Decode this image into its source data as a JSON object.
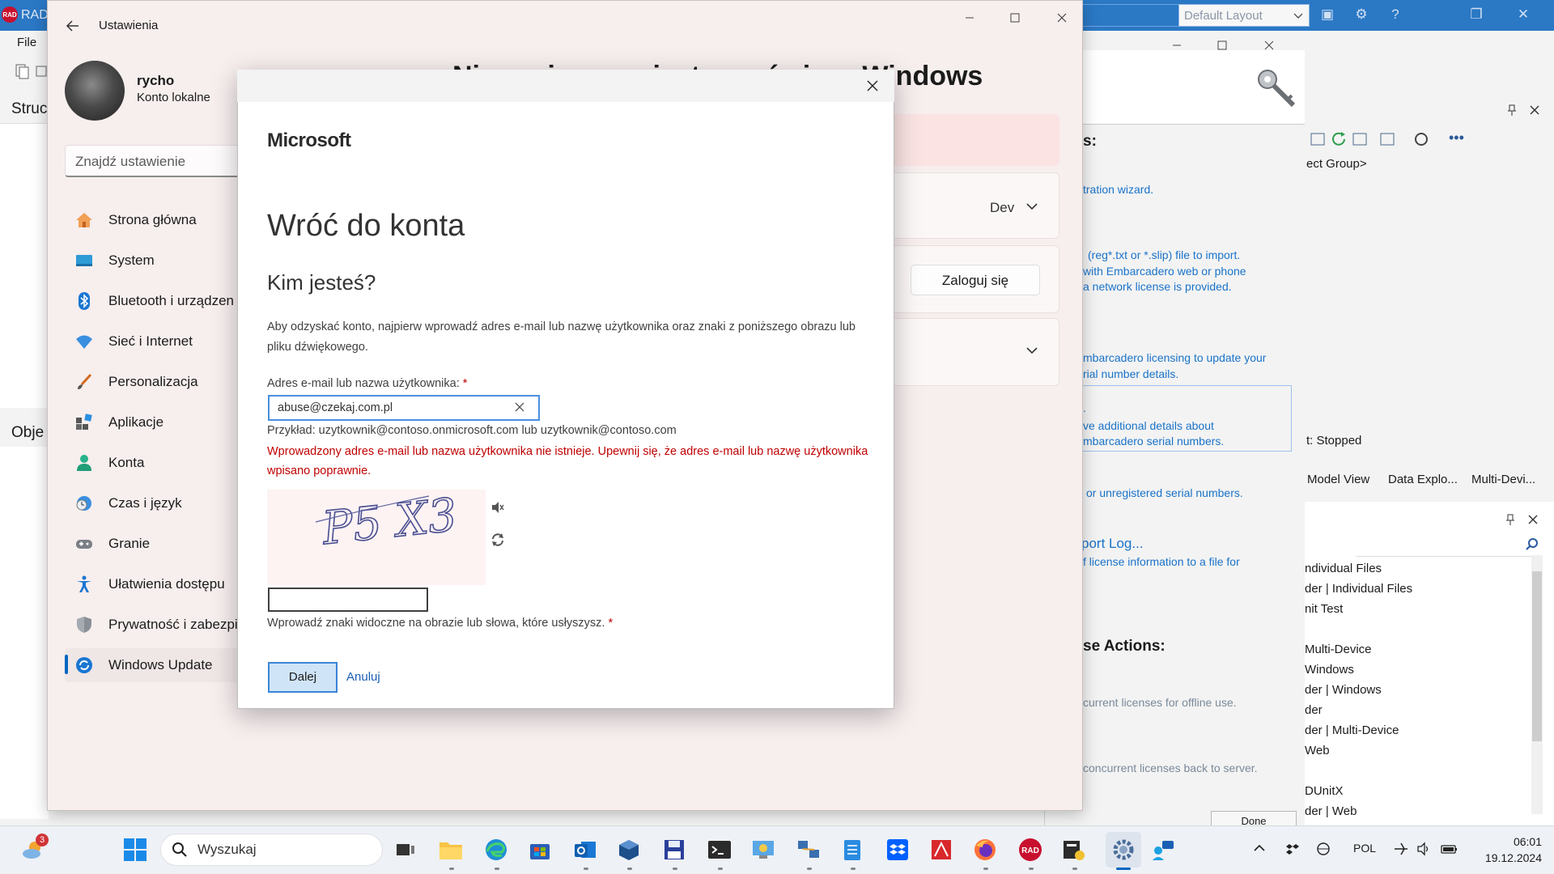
{
  "rad": {
    "logo": "RAD",
    "title": "RAD",
    "layout_select": "Default Layout",
    "menu_file": "File",
    "struct_label": "Struc",
    "obj_label": "Obje",
    "project_group": "ect Group>",
    "status": "t: Stopped",
    "tabs": [
      "Model View",
      "Data Explo...",
      "Multi-Devi..."
    ],
    "file_items": [
      "ndividual Files",
      "der | Individual Files",
      "nit Test",
      "",
      "Multi-Device",
      "Windows",
      "der | Windows",
      "der",
      "der | Multi-Device",
      "Web",
      "",
      "DUnitX",
      "der | Web"
    ],
    "done_label": "Done"
  },
  "license": {
    "heading1": "s:",
    "heading2": "se Actions:",
    "links": [
      "tration wizard.",
      "(reg*.txt or *.slip) file to import.",
      "with Embarcadero web or phone",
      "a network license is provided.",
      "mbarcadero licensing to update your",
      "rial number details.",
      ".",
      "ve additional details about",
      "mbarcadero serial numbers.",
      "or unregistered serial numbers.",
      "port Log...",
      "f  license information to a file for",
      "current licenses for offline use.",
      "concurrent licenses back to server."
    ]
  },
  "settings": {
    "title": "Ustawienia",
    "user_name": "rycho",
    "user_type": "Konto lokalne",
    "search_placeholder": "Znajdź ustawienie",
    "heading": "Nie można zarejestrować się w Windows",
    "nav": [
      {
        "label": "Strona główna",
        "icon": "home-icon"
      },
      {
        "label": "System",
        "icon": "system-icon"
      },
      {
        "label": "Bluetooth i urządzen",
        "icon": "bluetooth-icon"
      },
      {
        "label": "Sieć i Internet",
        "icon": "wifi-icon"
      },
      {
        "label": "Personalizacja",
        "icon": "brush-icon"
      },
      {
        "label": "Aplikacje",
        "icon": "apps-icon"
      },
      {
        "label": "Konta",
        "icon": "account-icon"
      },
      {
        "label": "Czas i język",
        "icon": "clock-globe-icon"
      },
      {
        "label": "Granie",
        "icon": "gamepad-icon"
      },
      {
        "label": "Ułatwienia dostępu",
        "icon": "accessibility-icon"
      },
      {
        "label": "Prywatność i zabezpi",
        "icon": "shield-icon"
      },
      {
        "label": "Windows Update",
        "icon": "update-icon"
      }
    ],
    "dev_label": "Dev",
    "login_button": "Zaloguj się"
  },
  "dialog": {
    "brand": "Microsoft",
    "title": "Wróć do konta",
    "subtitle": "Kim jesteś?",
    "intro": "Aby odzyskać konto, najpierw wprowadź adres e-mail lub nazwę użytkownika oraz znaki z poniższego obrazu lub pliku dźwiękowego.",
    "email_label": "Adres e-mail lub nazwa użytkownika:",
    "required_mark": "*",
    "email_value": "abuse@czekaj.com.pl",
    "example": "Przykład: uzytkownik@contoso.onmicrosoft.com lub uzytkownik@contoso.com",
    "error": "Wprowadzony adres e-mail lub nazwa użytkownika nie istnieje. Upewnij się, że adres e-mail lub nazwę użytkownika wpisano poprawnie.",
    "captcha_text": "P5 X3",
    "captcha_help": "Wprowadź znaki widoczne na obrazie lub słowa, które usłyszysz.",
    "next_button": "Dalej",
    "cancel_link": "Anuluj"
  },
  "taskbar": {
    "search_label": "Wyszukaj",
    "weather_badge": "3",
    "language": "POL",
    "time": "06:01",
    "date": "19.12.2024"
  },
  "colors": {
    "accent": "#0067c0",
    "error": "#c00000",
    "link": "#1a73c9",
    "rad_title": "#2b78c5"
  }
}
